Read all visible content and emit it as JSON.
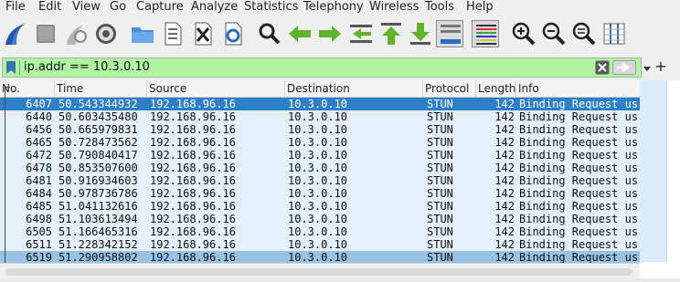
{
  "menu": {
    "file": "File",
    "edit": "Edit",
    "view": "View",
    "go": "Go",
    "capture": "Capture",
    "analyze": "Analyze",
    "statistics": "Statistics",
    "telephony": "Telephony",
    "wireless": "Wireless",
    "tools": "Tools",
    "help": "Help"
  },
  "toolbar": {
    "icons": [
      "shark-fin-icon",
      "stop-icon",
      "restart-icon",
      "options-gear-icon",
      "open-folder-icon",
      "file-binary-icon",
      "close-file-icon",
      "reload-icon",
      "find-icon",
      "go-back-icon",
      "go-forward-icon",
      "go-to-packet-icon",
      "first-packet-icon",
      "last-packet-icon",
      "autoscroll-icon",
      "colorize-icon",
      "zoom-in-icon",
      "zoom-out-icon",
      "zoom-normal-icon",
      "resize-columns-icon"
    ]
  },
  "filter": {
    "value": "ip.addr == 10.3.0.10",
    "color": "#b0f3a1"
  },
  "columns": {
    "no": "No.",
    "time": "Time",
    "source": "Source",
    "destination": "Destination",
    "protocol": "Protocol",
    "length": "Length",
    "info": "Info"
  },
  "rows": [
    {
      "no": "6407",
      "time": "50.543344932",
      "source": "192.168.96.16",
      "destination": "10.3.0.10",
      "protocol": "STUN",
      "length": "142",
      "info": "Binding Request us"
    },
    {
      "no": "6440",
      "time": "50.603435480",
      "source": "192.168.96.16",
      "destination": "10.3.0.10",
      "protocol": "STUN",
      "length": "142",
      "info": "Binding Request us"
    },
    {
      "no": "6456",
      "time": "50.665979831",
      "source": "192.168.96.16",
      "destination": "10.3.0.10",
      "protocol": "STUN",
      "length": "142",
      "info": "Binding Request us"
    },
    {
      "no": "6465",
      "time": "50.728473562",
      "source": "192.168.96.16",
      "destination": "10.3.0.10",
      "protocol": "STUN",
      "length": "142",
      "info": "Binding Request us"
    },
    {
      "no": "6472",
      "time": "50.790840417",
      "source": "192.168.96.16",
      "destination": "10.3.0.10",
      "protocol": "STUN",
      "length": "142",
      "info": "Binding Request us"
    },
    {
      "no": "6478",
      "time": "50.853507600",
      "source": "192.168.96.16",
      "destination": "10.3.0.10",
      "protocol": "STUN",
      "length": "142",
      "info": "Binding Request us"
    },
    {
      "no": "6481",
      "time": "50.916934603",
      "source": "192.168.96.16",
      "destination": "10.3.0.10",
      "protocol": "STUN",
      "length": "142",
      "info": "Binding Request us"
    },
    {
      "no": "6484",
      "time": "50.978736786",
      "source": "192.168.96.16",
      "destination": "10.3.0.10",
      "protocol": "STUN",
      "length": "142",
      "info": "Binding Request us"
    },
    {
      "no": "6485",
      "time": "51.041132616",
      "source": "192.168.96.16",
      "destination": "10.3.0.10",
      "protocol": "STUN",
      "length": "142",
      "info": "Binding Request us"
    },
    {
      "no": "6498",
      "time": "51.103613494",
      "source": "192.168.96.16",
      "destination": "10.3.0.10",
      "protocol": "STUN",
      "length": "142",
      "info": "Binding Request us"
    },
    {
      "no": "6505",
      "time": "51.166465316",
      "source": "192.168.96.16",
      "destination": "10.3.0.10",
      "protocol": "STUN",
      "length": "142",
      "info": "Binding Request us"
    },
    {
      "no": "6511",
      "time": "51.228342152",
      "source": "192.168.96.16",
      "destination": "10.3.0.10",
      "protocol": "STUN",
      "length": "142",
      "info": "Binding Request us"
    },
    {
      "no": "6519",
      "time": "51.290958802",
      "source": "192.168.96.16",
      "destination": "10.3.0.10",
      "protocol": "STUN",
      "length": "142",
      "info": "Binding Request us"
    }
  ],
  "selected_row": 0,
  "colors": {
    "row_bg": "#e4f1fc",
    "selected": "#2d7fca",
    "last_row": "#98c2e3"
  }
}
